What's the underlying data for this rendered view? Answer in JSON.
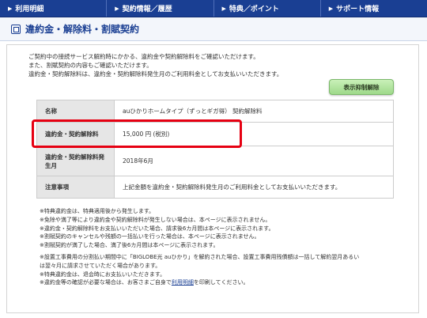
{
  "nav": {
    "tabs": [
      {
        "label": "利用明細"
      },
      {
        "label": "契約情報／履歴"
      },
      {
        "label": "特典／ポイント"
      },
      {
        "label": "サポート情報"
      }
    ]
  },
  "page": {
    "title": "違約金・解除料・割賦契約"
  },
  "intro": {
    "lines": [
      "ご契約中の接続サービス解約時にかかる、違約金や契約解除料をご確認いただけます。",
      "また、割賦契約の内容もご確認いただけます。",
      "違約金・契約解除料は、違約金・契約解除料発生月のご利用料金としてお支払いいただきます。"
    ]
  },
  "toggle_button": {
    "label": "表示抑制解除"
  },
  "table": {
    "rows": [
      {
        "header": "名称",
        "value": "auひかりホームタイプ（ずっとギガ得） 契約解除料"
      },
      {
        "header": "違約金・契約解除料",
        "value": "15,000 円 (税別)"
      },
      {
        "header": "違約金・契約解除料発生月",
        "value": "2018年6月"
      },
      {
        "header": "注意事項",
        "value": "上記金額を違約金・契約解除料発生月のご利用料金としてお支払いいただきます。"
      }
    ]
  },
  "notes": {
    "block1": [
      "※特典違約金は、特典適用後から発生します。",
      "※免除や満了等により違約金や契約解除料が発生しない場合は、本ページに表示されません。",
      "※違約金・契約解除料をお支払いいただいた場合、請求後6カ月間は本ページに表示されます。",
      "※割賦契約のキャンセルや残額の一括払いを行った場合は、本ページに表示されません。",
      "※割賦契約が満了した場合、満了後6カ月間は本ページに表示されます。"
    ],
    "block2": [
      "※設置工事費用の分割払い期間中に「BIGLOBE光 auひかり」を解約された場合、設置工事費用残債額は一括して解約翌月あるい",
      "は翌々月に請求させていただく場合があります。",
      "※特典違約金は、退会時にお支払いいただきます。"
    ],
    "last_prefix": "※違約金等の確認が必要な場合は、お客さまご自身で",
    "last_link": "利用明細",
    "last_suffix": "を印刷してください。"
  }
}
